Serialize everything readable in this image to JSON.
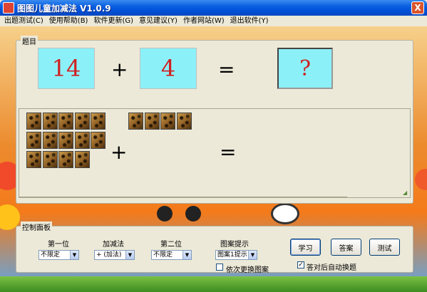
{
  "window": {
    "title": "图图儿童加减法  V1.0.9",
    "close_label": "X"
  },
  "menu": [
    "出题测试(C)",
    "使用帮助(B)",
    "软件更新(G)",
    "意见建议(Y)",
    "作者网站(W)",
    "退出软件(Y)"
  ],
  "question": {
    "group_label": "题目",
    "a": "14",
    "operator": "+",
    "b": "4",
    "equals": "=",
    "answer": "?",
    "pic_operator": "+",
    "pic_equals": "=",
    "count_a": 14,
    "count_b": 4
  },
  "control": {
    "group_label": "控制面板",
    "first_label": "第一位",
    "op_label": "加减法",
    "second_label": "第二位",
    "hint_label": "图案提示",
    "first_value": "不限定",
    "op_value": "+ (加法)",
    "second_value": "不限定",
    "hint_value": "图案1提示",
    "change_pic_label": "依次更换图案",
    "learn_button": "学习",
    "answer_button": "答案",
    "test_button": "测试",
    "auto_next_label": "答对后自动换题",
    "auto_next_checked": true
  }
}
